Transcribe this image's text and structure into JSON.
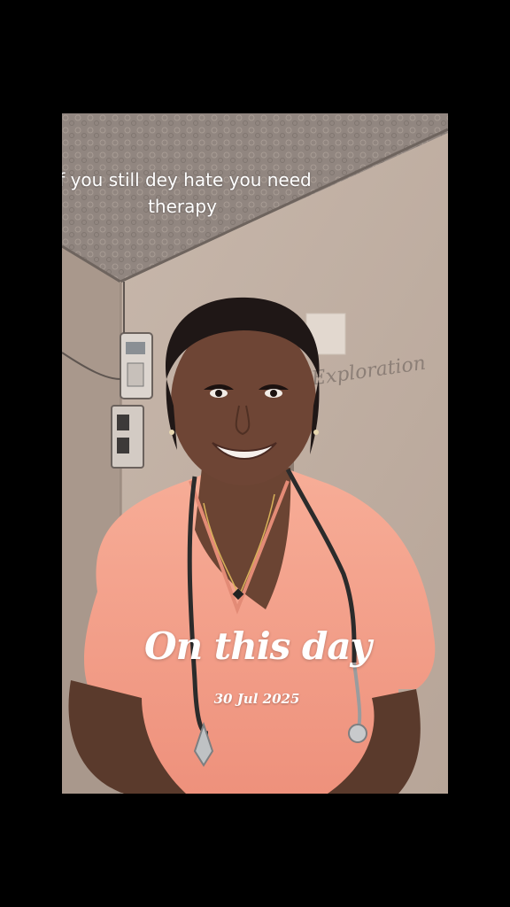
{
  "video": {
    "caption": "If you still dey hate you need therapy",
    "memory_title": "On this day",
    "memory_date": "30 Jul 2025",
    "wall_writing": "Exploration",
    "scene": "Smiling young woman in pink scrubs wearing a stethoscope in a room with an electric meter on the wall"
  },
  "colors": {
    "background": "#000000",
    "wall": "#bcaea3",
    "ceiling": "#8f847c",
    "scrubs": "#f2a08c",
    "overlay_text": "#ffffff"
  }
}
